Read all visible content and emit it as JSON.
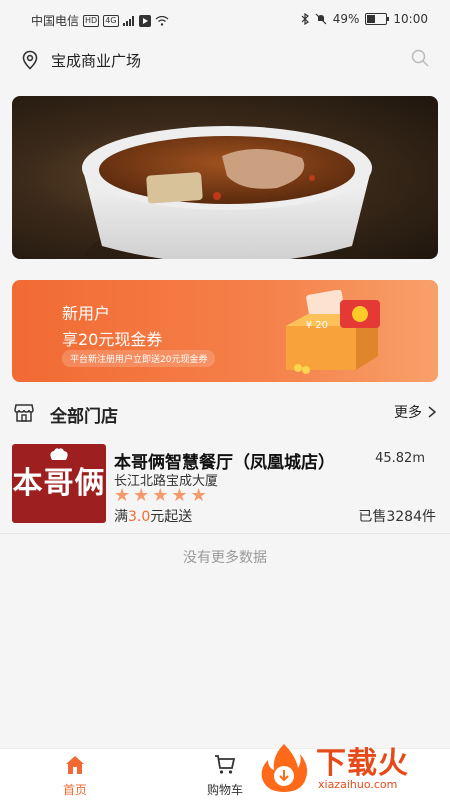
{
  "status_bar": {
    "carrier": "中国电信",
    "hd_badge": "HD",
    "signal_badge": "4G",
    "battery": "49%",
    "time": "10:00"
  },
  "location": {
    "name": "宝成商业广场"
  },
  "promo": {
    "title": "新用户",
    "subtitle": "享20元现金券",
    "note": "平台新注册用户立即送20元现金券",
    "coupon_amount": "¥ 20"
  },
  "section": {
    "title": "全部门店",
    "more_label": "更多"
  },
  "stores": [
    {
      "logo_text": "本哥俩",
      "name": "本哥俩智慧餐厅（凤凰城店）",
      "distance": "45.82m",
      "address": "长江北路宝成大厦",
      "rating": 5,
      "min_order_prefix": "满",
      "min_order_value": "3.0",
      "min_order_suffix": "元起送",
      "sold": "已售3284件"
    }
  ],
  "list_end_text": "没有更多数据",
  "tabbar": {
    "home_label": "首页",
    "cart_label": "购物车"
  },
  "watermark": {
    "text": "下载火",
    "subtext": "xiazaihuo.com"
  },
  "colors": {
    "accent": "#f26a33",
    "star": "#f59a6a",
    "logo_bg": "#9e1f1f"
  },
  "icons": [
    "location-pin-icon",
    "search-icon",
    "store-icon",
    "chevron-right-icon",
    "star-icon",
    "home-icon",
    "cart-icon"
  ]
}
